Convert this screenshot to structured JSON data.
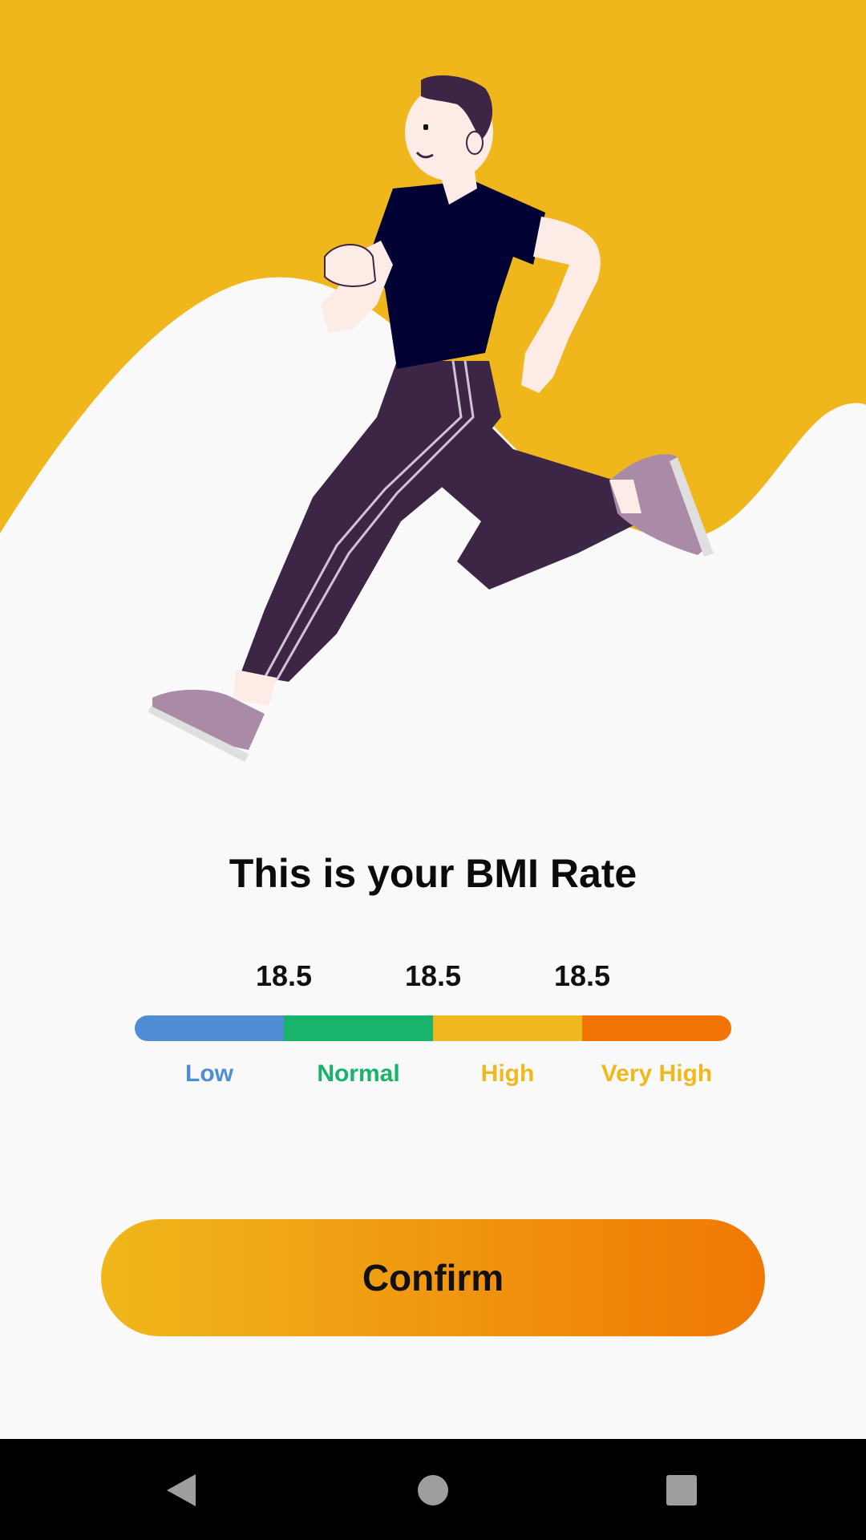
{
  "screen": {
    "title": "This is your BMI Rate"
  },
  "bmi": {
    "thresholds": [
      "18.5",
      "18.5",
      "18.5"
    ],
    "categories": [
      {
        "label": "Low",
        "color": "#4f8ed6"
      },
      {
        "label": "Normal",
        "color": "#19b36b"
      },
      {
        "label": "High",
        "color": "#f0b81e"
      },
      {
        "label": "Very High",
        "color": "#f27404"
      }
    ],
    "label_colors": [
      "#4f8ed6",
      "#19b36b",
      "#f0b81e",
      "#f0b81e"
    ]
  },
  "actions": {
    "confirm_label": "Confirm"
  },
  "theme": {
    "hero_background": "#efb71b",
    "page_background": "#f9f9f9",
    "button_gradient_start": "#f0b71b",
    "button_gradient_end": "#f07805"
  },
  "navigation": {
    "back_icon": "back-triangle-icon",
    "home_icon": "home-circle-icon",
    "recents_icon": "recents-square-icon"
  }
}
